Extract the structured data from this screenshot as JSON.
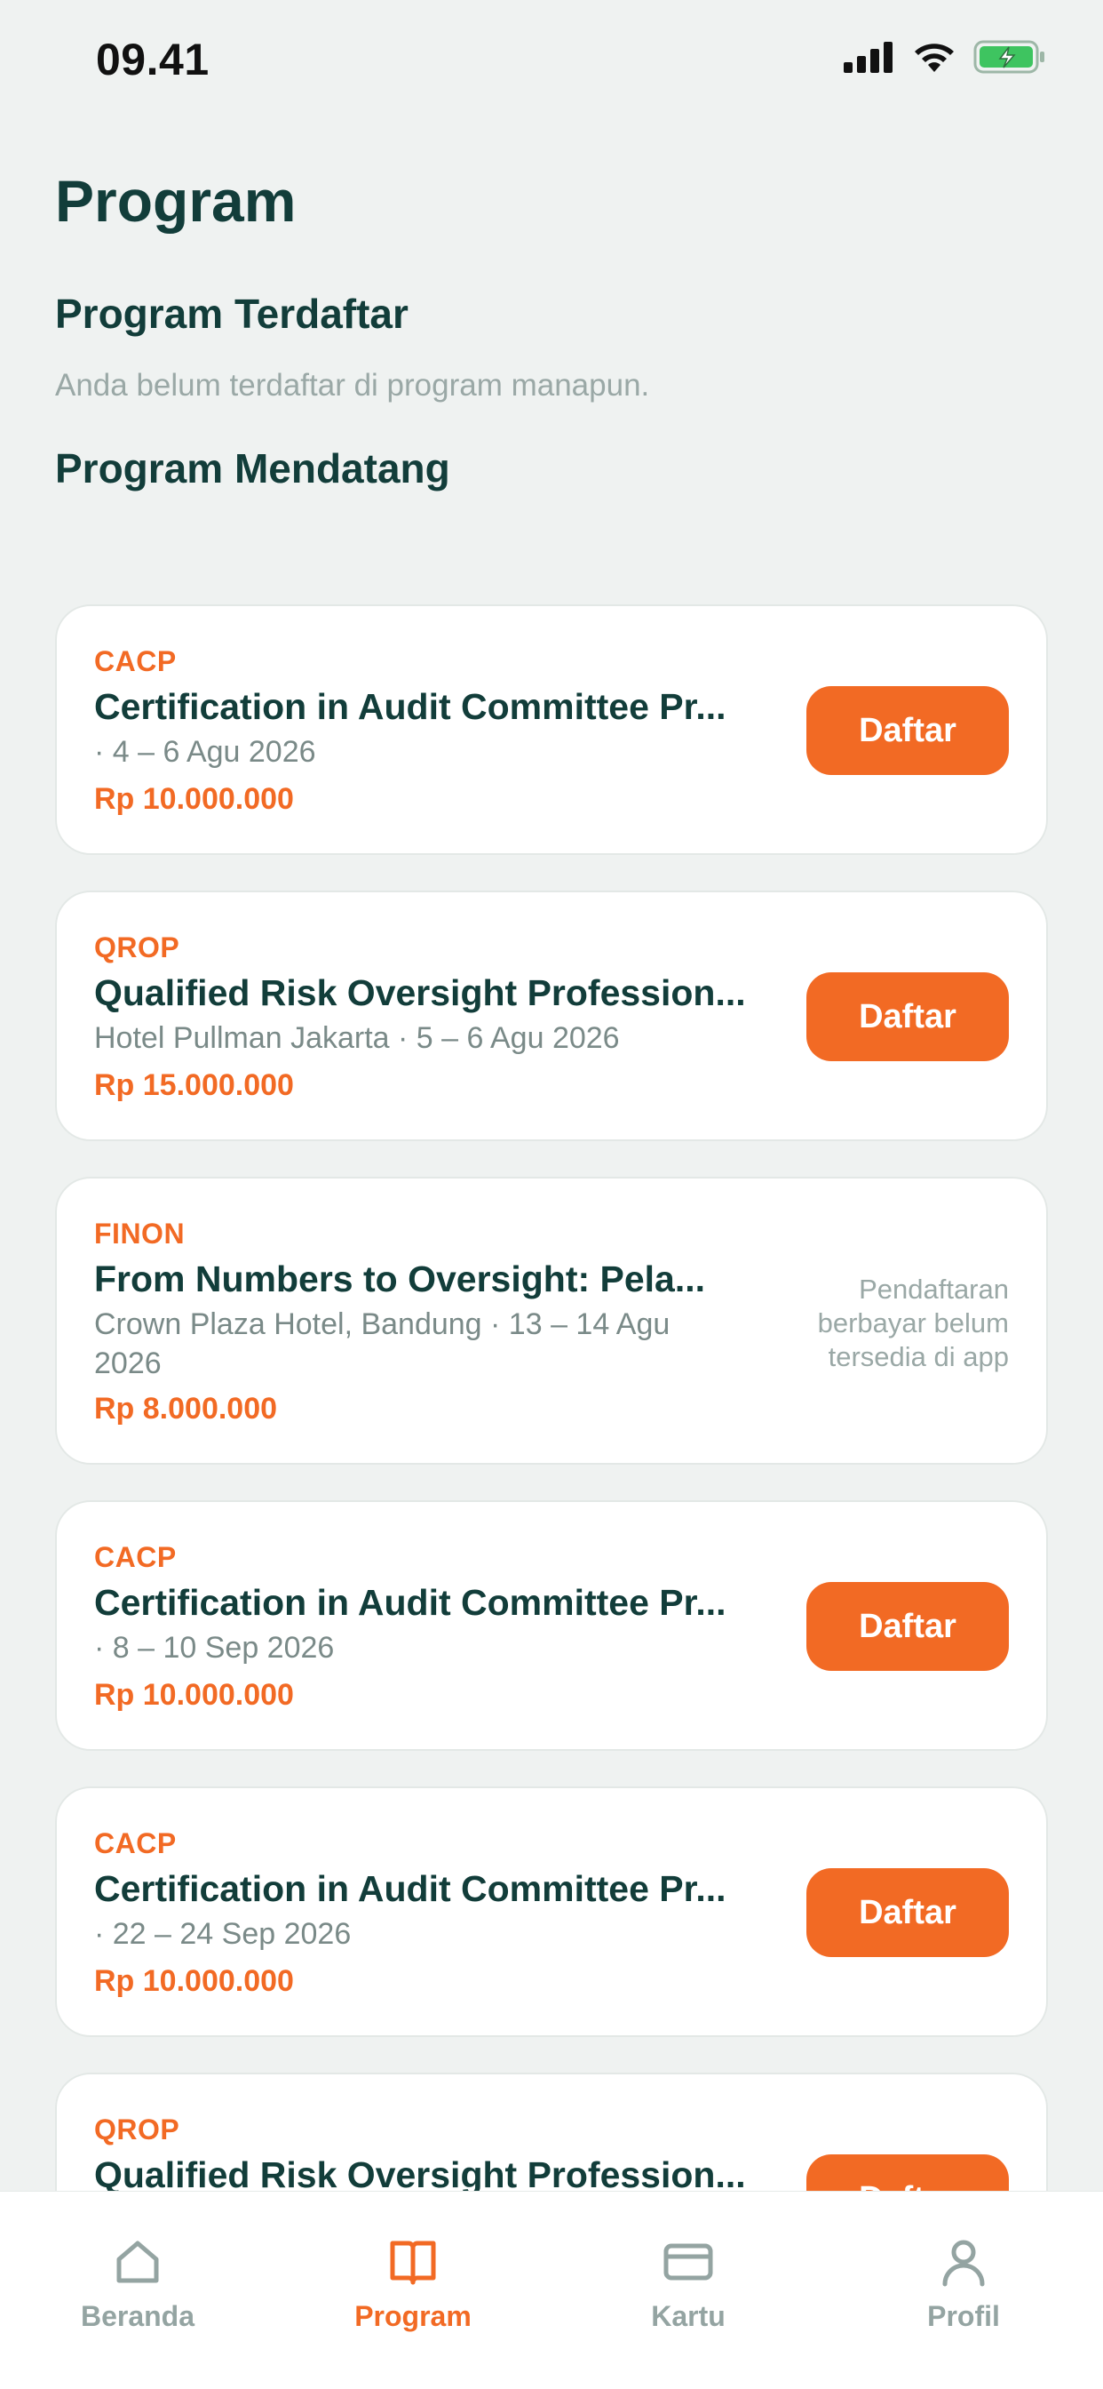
{
  "status_bar": {
    "time": "09.41"
  },
  "header": {
    "title": "Program"
  },
  "registered": {
    "title": "Program Terdaftar",
    "empty_text": "Anda belum terdaftar di program manapun."
  },
  "upcoming": {
    "title": "Program Mendatang",
    "items": [
      {
        "code": "CACP",
        "title": "Certification in Audit Committee Pr...",
        "meta": " · 4 – 6 Agu 2026",
        "price": "Rp 10.000.000",
        "button": "Daftar"
      },
      {
        "code": "QROP",
        "title": "Qualified Risk Oversight Profession...",
        "meta": "Hotel Pullman Jakarta · 5 – 6 Agu 2026",
        "price": "Rp 15.000.000",
        "button": "Daftar"
      },
      {
        "code": "FINON",
        "title": "From Numbers to Oversight: Pela...",
        "meta": "Crown Plaza Hotel, Bandung · 13 – 14 Agu 2026",
        "price": "Rp 8.000.000",
        "note": "Pendaftaran berbayar belum tersedia di app"
      },
      {
        "code": "CACP",
        "title": "Certification in Audit Committee Pr...",
        "meta": " · 8 – 10 Sep 2026",
        "price": "Rp 10.000.000",
        "button": "Daftar"
      },
      {
        "code": "CACP",
        "title": "Certification in Audit Committee Pr...",
        "meta": " · 22 – 24 Sep 2026",
        "price": "Rp 10.000.000",
        "button": "Daftar"
      },
      {
        "code": "QROP",
        "title": "Qualified Risk Oversight Profession...",
        "button": "Daftar"
      }
    ]
  },
  "tab_bar": {
    "tabs": [
      {
        "label": "Beranda",
        "icon": "home-icon",
        "active": false
      },
      {
        "label": "Program",
        "icon": "book-icon",
        "active": true
      },
      {
        "label": "Kartu",
        "icon": "card-icon",
        "active": false
      },
      {
        "label": "Profil",
        "icon": "person-icon",
        "active": false
      }
    ]
  },
  "colors": {
    "accent": "#f26a24",
    "heading": "#123d3a",
    "muted": "#9aa8a6",
    "background": "#eff2f1"
  }
}
